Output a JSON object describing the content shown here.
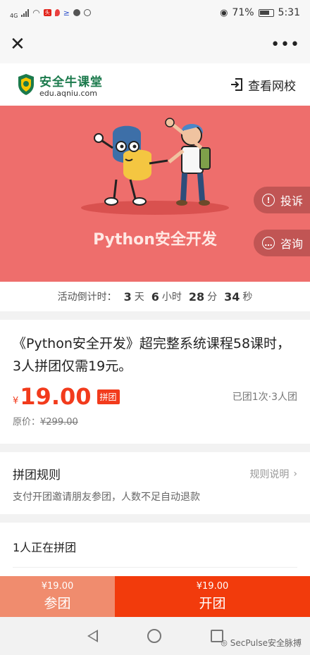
{
  "status_bar": {
    "network": "4G",
    "battery": "71%",
    "time": "5:31"
  },
  "header": {
    "logo_title": "安全牛课堂",
    "logo_url": "edu.aqniu.com",
    "view_school": "查看网校"
  },
  "banner": {
    "title": "Python安全开发",
    "complain": "投诉",
    "consult": "咨询",
    "bg_color": "#ee6e6c"
  },
  "countdown": {
    "label": "活动倒计时：",
    "days": "3",
    "days_unit": "天",
    "hours": "6",
    "hours_unit": "小时",
    "minutes": "28",
    "minutes_unit": "分",
    "seconds": "34",
    "seconds_unit": "秒"
  },
  "product": {
    "title": "《Python安全开发》超完整系统课程58课时， 3人拼团仅需19元。",
    "currency": "¥",
    "price": "19.00",
    "tag": "拼团",
    "group_count": "已团1次·3人团",
    "original_label": "原价：",
    "original_price": "¥299.00"
  },
  "rules": {
    "title": "拼团规则",
    "link": "规则说明",
    "desc": "支付开团邀请朋友参团，人数不足自动退款"
  },
  "group_section": {
    "title": "1人正在拼团"
  },
  "actions": {
    "join_price": "¥19.00",
    "join_label": "参团",
    "open_price": "¥19.00",
    "open_label": "开团"
  },
  "watermark": "SecPulse安全脉搏"
}
